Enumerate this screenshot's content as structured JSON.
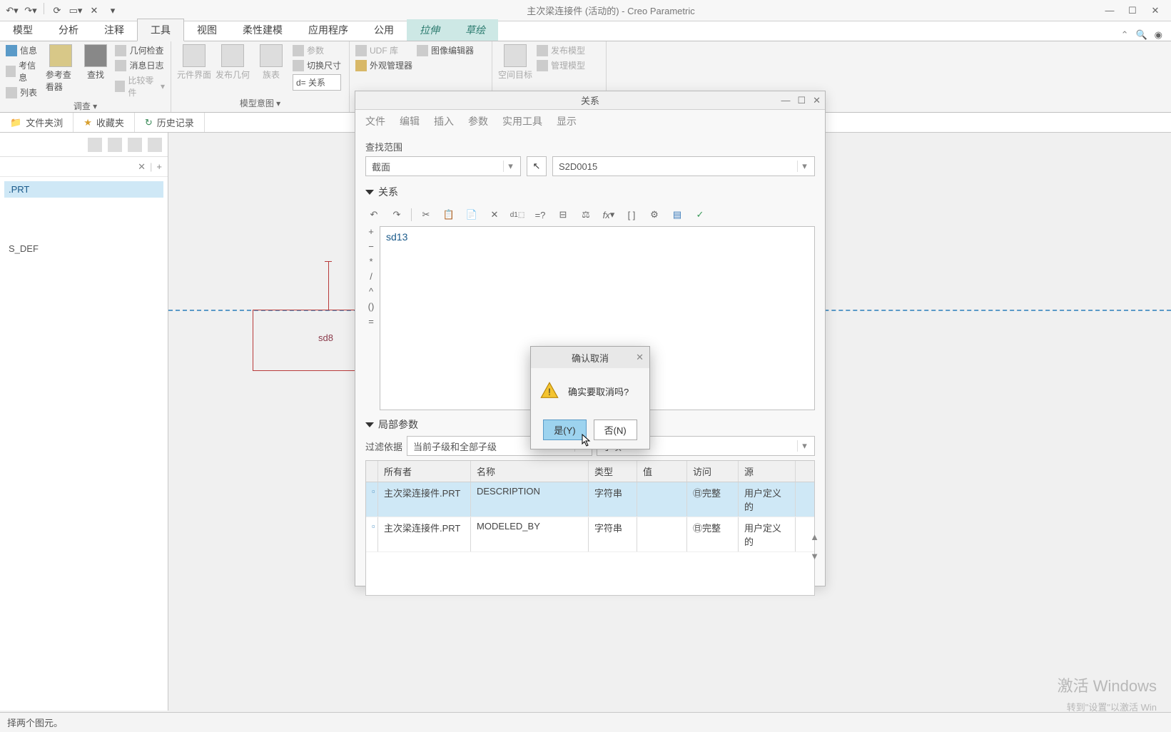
{
  "title": "主次梁连接件 (活动的) - Creo Parametric",
  "ribbon_tabs": {
    "model": "模型",
    "analysis": "分析",
    "annotate": "注释",
    "tools": "工具",
    "view": "视图",
    "flex": "柔性建模",
    "apps": "应用程序",
    "pub": "公用",
    "extrude": "拉伸",
    "sketch": "草绘"
  },
  "ribbon": {
    "g1": {
      "info": "信息",
      "ref_info": "考信息",
      "list": "列表",
      "ref_view": "参考查看器",
      "find": "查找",
      "label": "调查"
    },
    "g1_right": {
      "geo_check": "几何检查",
      "msg_log": "消息日志",
      "compare": "比较零件"
    },
    "g2": {
      "comp_if": "元件界面",
      "pub_geo": "发布几何",
      "family": "族表",
      "params": "参数",
      "switch_dim": "切换尺寸",
      "d_rel": "d= 关系",
      "label": "模型意图"
    },
    "g3": {
      "udf": "UDF 库",
      "appearance": "外观管理器",
      "img_edit": "图像编辑器"
    },
    "g4": {
      "space": "空间目标",
      "pub_model": "发布模型",
      "manage": "管理模型"
    }
  },
  "panel_tabs": {
    "folder": "文件夹浏",
    "fav": "收藏夹",
    "history": "历史记录"
  },
  "tree": {
    "item1": ".PRT",
    "item2": "S_DEF"
  },
  "sketch": {
    "dim": "sd8"
  },
  "relations": {
    "title": "关系",
    "menu": {
      "file": "文件",
      "edit": "编辑",
      "insert": "插入",
      "params": "参数",
      "util": "实用工具",
      "show": "显示"
    },
    "scope_label": "查找范围",
    "scope_value": "截面",
    "scope_name": "S2D0015",
    "rel_label": "关系",
    "editor_text": "sd13",
    "ops": [
      "+",
      "−",
      "*",
      "/",
      "^",
      "()",
      "="
    ],
    "local_params": "局部参数",
    "filter_label": "过滤依据",
    "filter_value": "当前子级和全部子级",
    "filter_right": "子项",
    "cols": {
      "owner": "所有者",
      "name": "名称",
      "type": "类型",
      "value": "值",
      "access": "访问",
      "source": "源"
    },
    "rows": [
      {
        "owner": "主次梁连接件.PRT",
        "name": "DESCRIPTION",
        "type": "字符串",
        "value": "",
        "access": "㊐完整",
        "source": "用户定义的"
      },
      {
        "owner": "主次梁连接件.PRT",
        "name": "MODELED_BY",
        "type": "字符串",
        "value": "",
        "access": "㊐完整",
        "source": "用户定义的"
      }
    ]
  },
  "confirm": {
    "title": "确认取消",
    "message": "确实要取消吗?",
    "yes": "是(Y)",
    "no": "否(N)"
  },
  "status": "择两个图元。",
  "watermark": "激活 Windows",
  "watermark_sub": "转到\"设置\"以激活 Win"
}
